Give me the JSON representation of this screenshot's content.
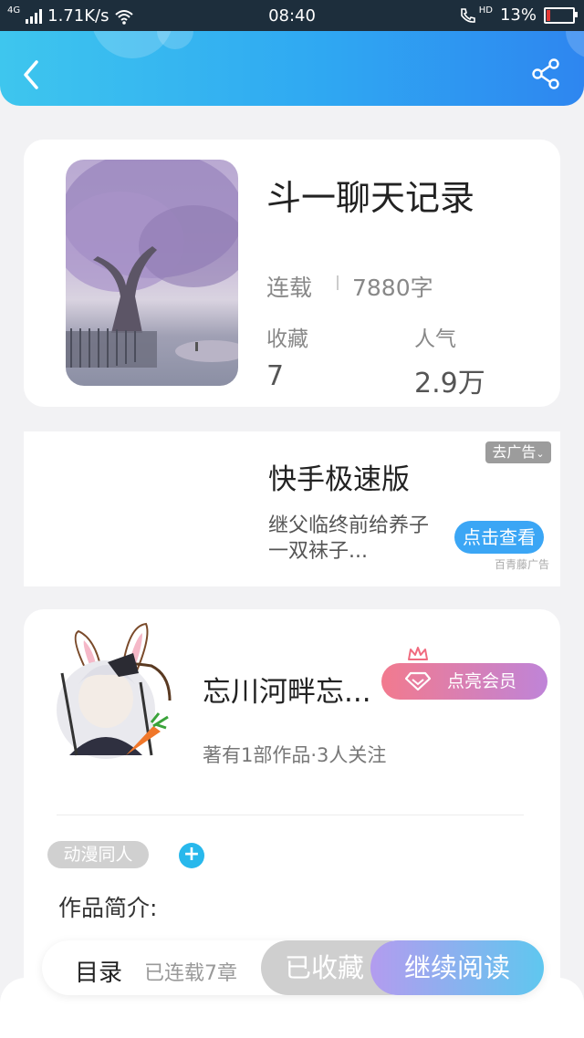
{
  "status_bar": {
    "network_label": "4G",
    "speed": "1.71K/s",
    "time": "08:40",
    "hd_label": "HD",
    "battery": "13%",
    "battery_level": 0.13,
    "icons": [
      "signal-icon",
      "wifi-icon",
      "phone-icon",
      "battery-icon"
    ]
  },
  "header": {
    "back_icon": "chevron-left-icon",
    "share_icon": "share-icon",
    "accent": "#2fa8f2"
  },
  "book": {
    "title": "斗一聊天记录",
    "status": "连载",
    "word_count": "7880字",
    "favorites_label": "收藏",
    "favorites_value": "7",
    "popularity_label": "人气",
    "popularity_value": "2.9万"
  },
  "ad": {
    "title": "快手极速版",
    "description": "继父临终前给养子一双袜子...",
    "button": "点击查看",
    "close_label": "去广告",
    "source": "百青藤广告"
  },
  "author": {
    "name": "忘川河畔忘...",
    "vip_button": "点亮会员",
    "stats": "著有1部作品·3人关注",
    "tag": "动漫同人",
    "tag_add": "+",
    "intro_label": "作品简介:"
  },
  "bottom_bar": {
    "toc": "目录",
    "chapters": "已连载7章",
    "collected": "已收藏",
    "continue": "继续阅读"
  }
}
